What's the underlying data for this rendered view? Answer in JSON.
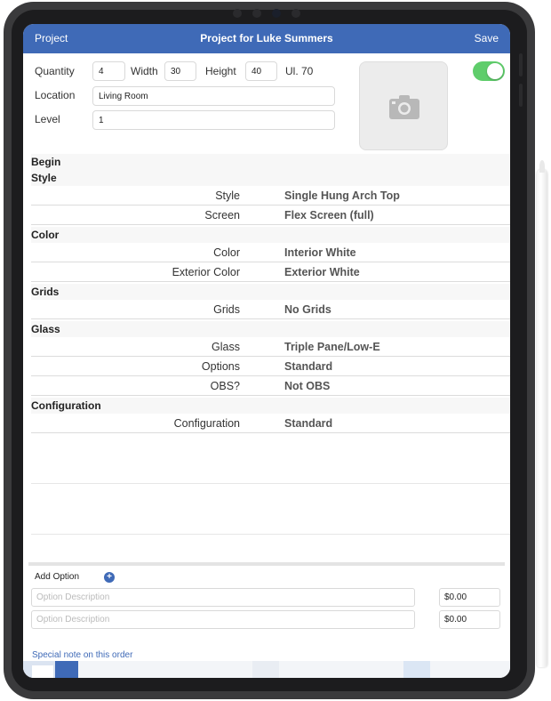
{
  "navbar": {
    "back_label": "Project",
    "title": "Project for Luke Summers",
    "save_label": "Save"
  },
  "header": {
    "quantity_label": "Quantity",
    "quantity_value": "4",
    "width_label": "Width",
    "width_value": "30",
    "height_label": "Height",
    "height_value": "40",
    "ui_label": "Ul. 70",
    "location_label": "Location",
    "location_value": "Living Room",
    "level_label": "Level",
    "level_value": "1",
    "toggle_on": true
  },
  "sections": {
    "begin": "Begin",
    "style": "Style",
    "color": "Color",
    "grids": "Grids",
    "glass": "Glass",
    "configuration": "Configuration"
  },
  "rows": {
    "style": {
      "label": "Style",
      "value": "Single Hung Arch Top"
    },
    "screen": {
      "label": "Screen",
      "value": "Flex Screen (full)"
    },
    "color": {
      "label": "Color",
      "value": "Interior White"
    },
    "exterior_color": {
      "label": "Exterior Color",
      "value": "Exterior White"
    },
    "grids": {
      "label": "Grids",
      "value": "No Grids"
    },
    "glass": {
      "label": "Glass",
      "value": "Triple Pane/Low-E"
    },
    "options": {
      "label": "Options",
      "value": "Standard"
    },
    "obs": {
      "label": "OBS?",
      "value": "Not OBS"
    },
    "configuration": {
      "label": "Configuration",
      "value": "Standard"
    }
  },
  "add_option": {
    "label": "Add Option",
    "plus_icon": "plus-circle-icon",
    "options": [
      {
        "placeholder": "Option Description",
        "price": "$0.00"
      },
      {
        "placeholder": "Option Description",
        "price": "$0.00"
      }
    ]
  },
  "special_note": "Special note on this order",
  "colors": {
    "nav_blue": "#3f6ab7",
    "toggle_green": "#5fcd6b"
  }
}
